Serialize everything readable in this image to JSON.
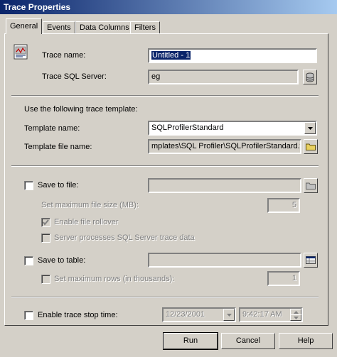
{
  "window": {
    "title": "Trace Properties"
  },
  "tabs": [
    {
      "label": "General",
      "active": true
    },
    {
      "label": "Events"
    },
    {
      "label": "Data Columns"
    },
    {
      "label": "Filters"
    }
  ],
  "general": {
    "trace_name_label": "Trace name:",
    "trace_name_value": "Untitled - 1",
    "trace_server_label": "Trace SQL Server:",
    "trace_server_value": "eg",
    "template_heading": "Use the following trace template:",
    "template_name_label": "Template name:",
    "template_name_value": "SQLProfilerStandard",
    "template_file_label": "Template file name:",
    "template_file_value": "mplates\\SQL Profiler\\SQLProfilerStandard.tdf",
    "save_to_file_label": "Save to file:",
    "max_file_size_label": "Set maximum file size (MB):",
    "max_file_size_value": "5",
    "enable_rollover_label": "Enable file rollover",
    "server_processes_label": "Server processes SQL Server trace data",
    "save_to_table_label": "Save to table:",
    "max_rows_label": "Set maximum rows (in thousands):",
    "max_rows_value": "1",
    "stop_time_label": "Enable trace stop time:",
    "stop_date_value": "12/23/2001",
    "stop_time_value": "9:42:17 AM"
  },
  "buttons": {
    "run": "Run",
    "cancel": "Cancel",
    "help": "Help"
  }
}
